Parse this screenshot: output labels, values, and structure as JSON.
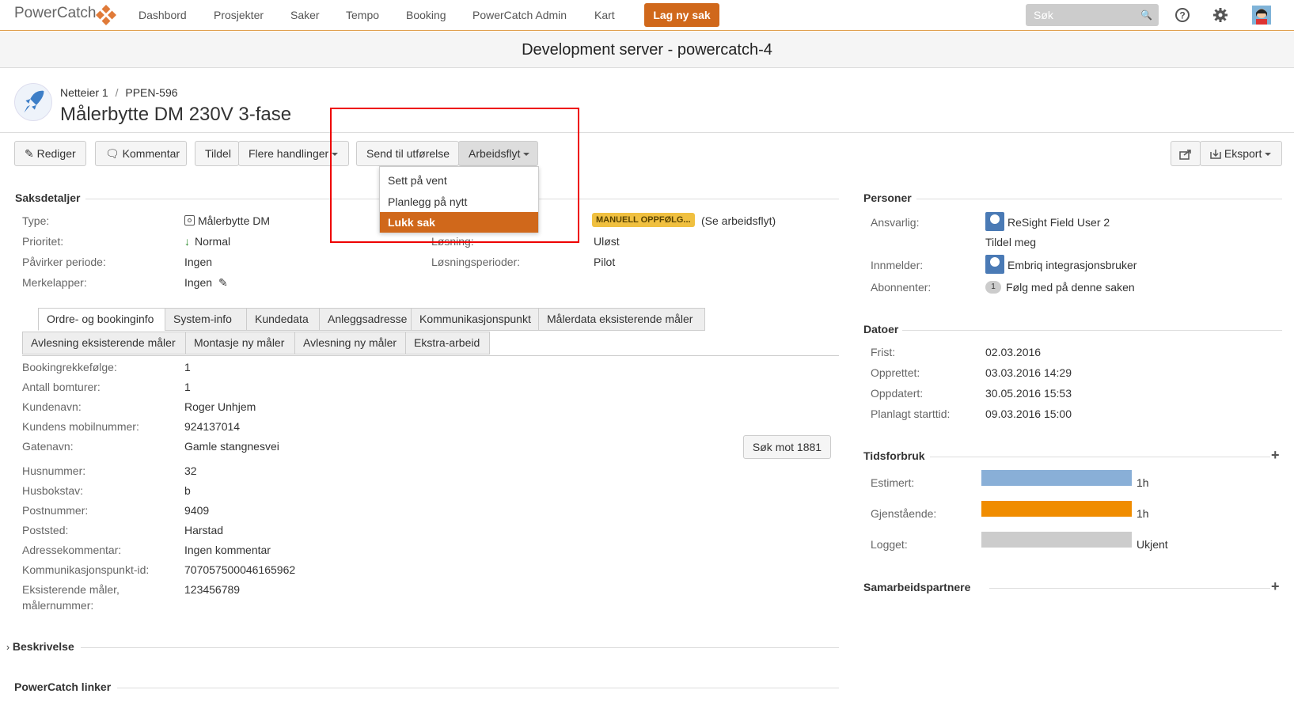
{
  "nav": {
    "logo": "PowerCatch",
    "items": [
      "Dashbord",
      "Prosjekter",
      "Saker",
      "Tempo",
      "Booking",
      "PowerCatch Admin",
      "Kart"
    ],
    "create_label": "Lag ny sak",
    "search_placeholder": "Søk"
  },
  "devbar": "Development server - powercatch-4",
  "issue": {
    "breadcrumb_project": "Netteier 1",
    "breadcrumb_sep": "/",
    "breadcrumb_key": "PPEN-596",
    "title": "Målerbytte DM 230V 3-fase"
  },
  "toolbar": {
    "edit": "Rediger",
    "comment": "Kommentar",
    "assign": "Tildel",
    "more": "Flere handlinger",
    "send": "Send til utførelse",
    "workflow": "Arbeidsflyt",
    "export": "Eksport"
  },
  "workflow_menu": [
    "Sett på vent",
    "Planlegg på nytt",
    "Lukk sak"
  ],
  "details": {
    "title": "Saksdetaljer",
    "type_label": "Type:",
    "type_value": "Målerbytte DM",
    "priority_label": "Prioritet:",
    "priority_value": "Normal",
    "period_label": "Påvirker periode:",
    "period_value": "Ingen",
    "labels_label": "Merkelapper:",
    "labels_value": "Ingen",
    "status_badge": "MANUELL OPPFØLG...",
    "status_link": "(Se arbeidsflyt)",
    "resolution_label": "Løsning:",
    "resolution_value": "Uløst",
    "res_periods_label": "Løsningsperioder:",
    "res_periods_value": "Pilot"
  },
  "tabs_row1": [
    "Ordre- og bookinginfo",
    "System-info",
    "Kundedata",
    "Anleggsadresse",
    "Kommunikasjonspunkt",
    "Målerdata eksisterende måler"
  ],
  "tabs_row2": [
    "Avlesning eksisterende måler",
    "Montasje ny måler",
    "Avlesning ny måler",
    "Ekstra-arbeid"
  ],
  "fields": [
    {
      "label": "Bookingrekkefølge:",
      "value": "1"
    },
    {
      "label": "Antall bomturer:",
      "value": "1"
    },
    {
      "label": "Kundenavn:",
      "value": "Roger Unhjem"
    },
    {
      "label": "Kundens mobilnummer:",
      "value": "924137014"
    },
    {
      "label": "Gatenavn:",
      "value": "Gamle stangnesvei"
    },
    {
      "label": "Husnummer:",
      "value": "32"
    },
    {
      "label": "Husbokstav:",
      "value": "b"
    },
    {
      "label": "Postnummer:",
      "value": "9409"
    },
    {
      "label": "Poststed:",
      "value": "Harstad"
    },
    {
      "label": "Adressekommentar:",
      "value": "Ingen kommentar"
    },
    {
      "label": "Kommunikasjonspunkt-id:",
      "value": "707057500046165962"
    },
    {
      "label": "Eksisterende måler, målernummer:",
      "value": "123456789"
    }
  ],
  "search_1881": "Søk mot 1881",
  "beskrivelse": "Beskrivelse",
  "pc_links": "PowerCatch linker",
  "persons": {
    "title": "Personer",
    "resp_label": "Ansvarlig:",
    "resp_value": "ReSight Field User 2",
    "assign_me": "Tildel meg",
    "reporter_label": "Innmelder:",
    "reporter_value": "Embriq integrasjonsbruker",
    "watchers_label": "Abonnenter:",
    "watchers_count": "1",
    "watch_link": "Følg med på denne saken"
  },
  "dates": {
    "title": "Datoer",
    "rows": [
      {
        "label": "Frist:",
        "value": "02.03.2016"
      },
      {
        "label": "Opprettet:",
        "value": "03.03.2016 14:29"
      },
      {
        "label": "Oppdatert:",
        "value": "30.05.2016 15:53"
      },
      {
        "label": "Planlagt starttid:",
        "value": "09.03.2016 15:00"
      }
    ]
  },
  "time": {
    "title": "Tidsforbruk",
    "estimated_label": "Estimert:",
    "estimated_value": "1h",
    "remaining_label": "Gjenstående:",
    "remaining_value": "1h",
    "logged_label": "Logget:",
    "logged_value": "Ukjent",
    "colors": {
      "estimated": "#89afd7",
      "remaining": "#f08c00",
      "logged": "#cccccc"
    }
  },
  "partners": "Samarbeidspartnere"
}
